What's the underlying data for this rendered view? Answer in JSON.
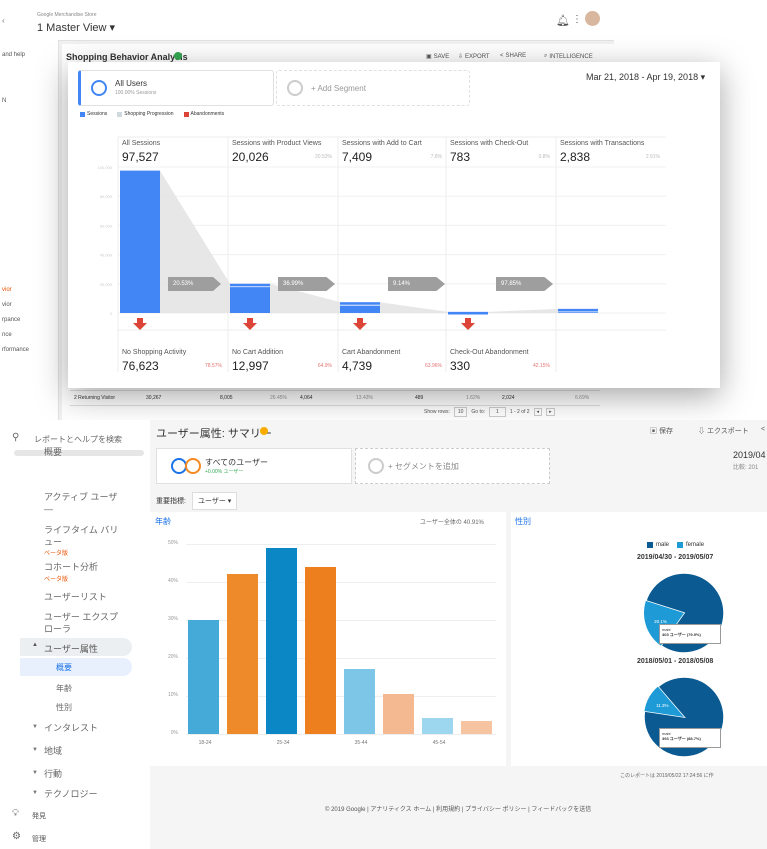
{
  "top_window": {
    "store_name": "Google Merchandise Store",
    "view_name": "1 Master View ▾",
    "left_strip": [
      "and help",
      "N",
      "vior",
      "vior",
      "rpance",
      "nce",
      "rformance"
    ],
    "report_title": "Shopping Behavior Analysis",
    "toolbar": {
      "save": "SAVE",
      "export": "EXPORT",
      "share": "SHARE",
      "intelligence": "INTELLIGENCE"
    },
    "table_row": {
      "label": "2  Returning Visitor",
      "cells": [
        "30,267",
        "8,005",
        "26.45%",
        "4,064",
        "13.43%",
        "489",
        "1.62%",
        "2,024",
        "6.69%"
      ]
    },
    "pagination": {
      "show_rows_label": "Show rows:",
      "show_rows_value": "10",
      "goto_label": "Go to:",
      "goto_value": "1",
      "range": "1 - 2 of 2"
    }
  },
  "funnel_panel": {
    "segment_all_users": "All Users",
    "segment_all_users_sub": "100.00% Sessions",
    "add_segment": "+ Add Segment",
    "date_range": "Mar 21, 2018 - Apr 19, 2018 ▾",
    "legend": [
      {
        "label": "Sessions",
        "color": "#4285f4"
      },
      {
        "label": "Shopping Progression",
        "color": "#cfd8dc"
      },
      {
        "label": "Abandonments",
        "color": "#db4437"
      }
    ],
    "y_ticks": [
      "100,000",
      "80,000",
      "60,000",
      "40,000",
      "20,000",
      "0"
    ],
    "columns": [
      {
        "title": "All Sessions",
        "value": "97,527",
        "pct": "",
        "tag": "20.53%"
      },
      {
        "title": "Sessions with Product Views",
        "value": "20,026",
        "pct": "20.53%",
        "tag": "36.99%"
      },
      {
        "title": "Sessions with Add to Cart",
        "value": "7,409",
        "pct": "7.6%",
        "tag": "9.14%"
      },
      {
        "title": "Sessions with Check-Out",
        "value": "783",
        "pct": "0.8%",
        "tag": "97.85%"
      },
      {
        "title": "Sessions with Transactions",
        "value": "2,838",
        "pct": "2.91%",
        "tag": ""
      }
    ],
    "abandonments": [
      {
        "title": "No Shopping Activity",
        "value": "76,623",
        "pct": "78.57%"
      },
      {
        "title": "No Cart Addition",
        "value": "12,997",
        "pct": "64.9%"
      },
      {
        "title": "Cart Abandonment",
        "value": "4,739",
        "pct": "63.96%"
      },
      {
        "title": "Check-Out Abandonment",
        "value": "330",
        "pct": "42.15%"
      }
    ]
  },
  "chart_data": [
    {
      "type": "bar",
      "title": "",
      "categories": [
        "All Sessions",
        "Sessions with Product Views",
        "Sessions with Add to Cart",
        "Sessions with Check-Out",
        "Sessions with Transactions"
      ],
      "values": [
        97527,
        20026,
        7409,
        783,
        2838
      ],
      "ylim": [
        0,
        100000
      ]
    },
    {
      "type": "bar",
      "title": "年齢",
      "categories": [
        "18-24",
        "",
        "25-34",
        "",
        "35-44",
        "",
        "45-54",
        ""
      ],
      "series": [
        {
          "values": [
            30,
            42,
            49,
            44,
            17,
            10.5,
            4.3,
            3.5
          ]
        }
      ],
      "colors": [
        "#45aad8",
        "#ee8a2a",
        "#0b87c6",
        "#ee7f1e",
        "#7dc6e7",
        "#f4b990",
        "#9dd6ef",
        "#f6c4a0"
      ],
      "ylim": [
        0,
        50
      ],
      "y_ticks": [
        "50%",
        "40%",
        "30%",
        "20%",
        "10%",
        "0%"
      ]
    },
    {
      "type": "pie",
      "title": "2019/04/30 - 2019/05/07",
      "series": [
        {
          "name": "male",
          "value": 79.9
        },
        {
          "name": "female",
          "value": 20.1
        }
      ],
      "slice_labels": [
        "20.1%"
      ]
    },
    {
      "type": "pie",
      "title": "2018/05/01 - 2018/05/08",
      "series": [
        {
          "name": "male",
          "value": 88.7
        },
        {
          "name": "female",
          "value": 11.3
        }
      ],
      "slice_labels": [
        "11.3%"
      ]
    }
  ],
  "bottom_window": {
    "search_placeholder": "レポートとヘルプを検索",
    "sidebar_items": [
      {
        "label": "概要"
      },
      {
        "label": "アクティブ ユーザ\n—"
      },
      {
        "label": "ライフタイム バリ\nュー",
        "badge": "ベータ版"
      },
      {
        "label": "コホート分析",
        "badge": "ベータ版"
      },
      {
        "label": "ユーザーリスト"
      },
      {
        "label": "ユーザー エクスプ\nローラ"
      }
    ],
    "sidebar_section": "ユーザー属性",
    "sidebar_sub": [
      "概要",
      "年齢",
      "性別"
    ],
    "sidebar_groups": [
      "インタレスト",
      "地域",
      "行動",
      "テクノロジー"
    ],
    "discover": "発見",
    "admin": "管理",
    "page_title": "ユーザー属性: サマリー",
    "save_label": "保存",
    "export_label": "エクスポート",
    "date_partial": "2019/04",
    "compare_partial": "比較: 201",
    "segment_label": "すべてのユーザー",
    "segment_sub": "+0.00% ユーザー",
    "add_segment": "+ セグメントを追加",
    "primary_dim_label": "重要指標:",
    "primary_dim_value": "ユーザー ▾",
    "age_card_title": "年齢",
    "age_card_note": "ユーザー全体の 40.91%",
    "gender_card_title": "性別",
    "legend_male": "male",
    "legend_female": "female",
    "pie1_tip_name": "male",
    "pie1_tip_val": "403 ユーザー (79.9%)",
    "pie2_tip_name": "male",
    "pie2_tip_val": "393 ユーザー (88.7%)",
    "report_created": "このレポートは 2019/05/22 17:24:56 に作",
    "footer": "© 2019 Google | アナリティクス ホーム | 利用規約 | プライバシー ポリシー | フィードバックを送信"
  }
}
